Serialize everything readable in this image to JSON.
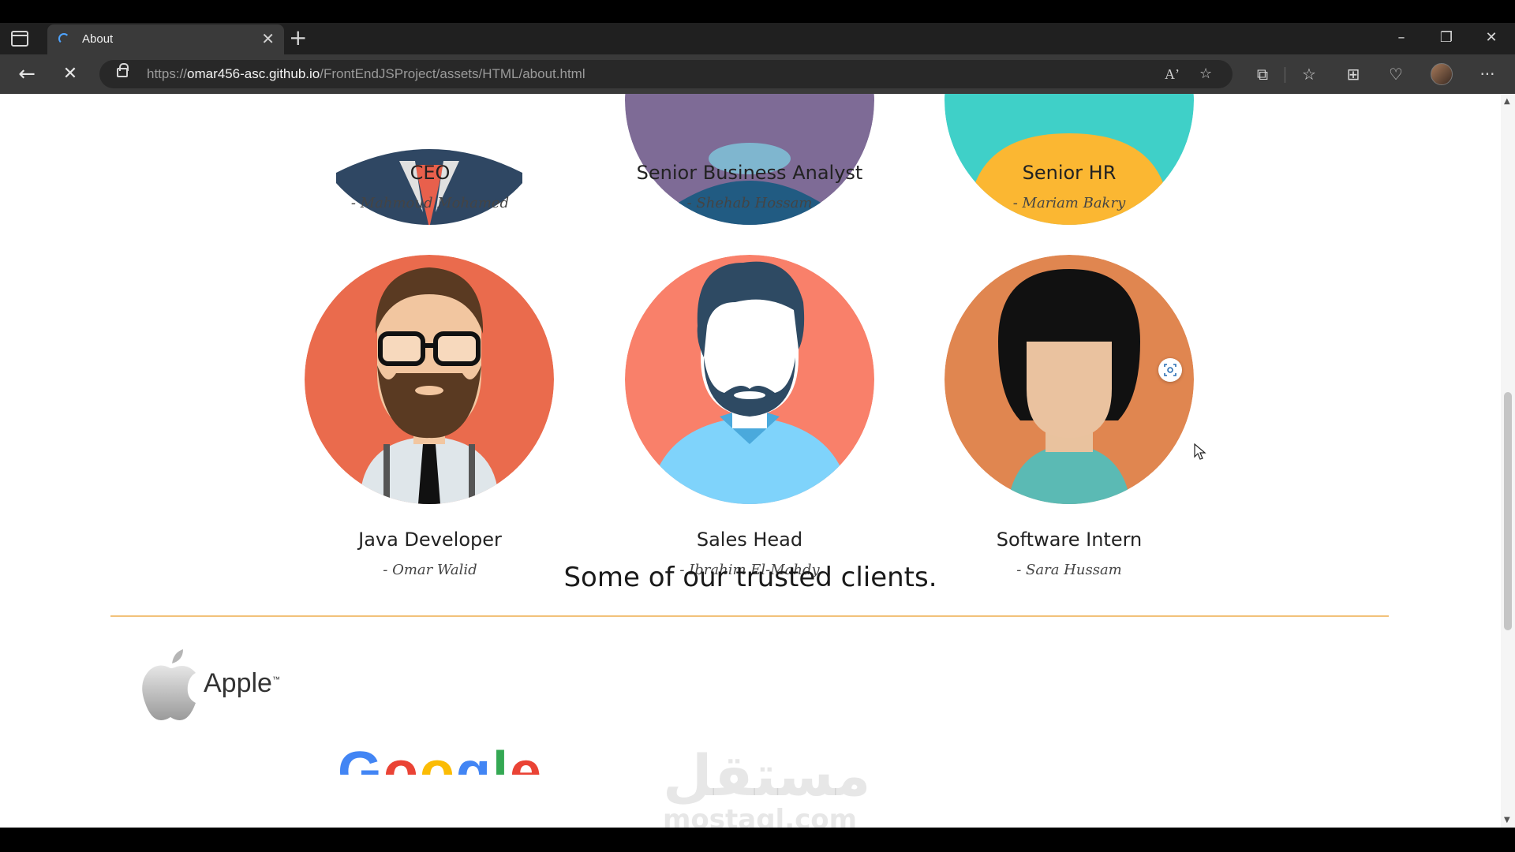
{
  "browser": {
    "tab_title": "About",
    "url_prefix": "https://",
    "url_host": "omar456-asc.github.io",
    "url_path": "/FrontEndJSProject/assets/HTML/about.html",
    "close_tab_glyph": "✕",
    "new_tab_glyph": "+",
    "minimize_glyph": "–",
    "restore_glyph": "❐",
    "close_window_glyph": "✕",
    "back_glyph": "←",
    "stop_glyph": "✕",
    "more_glyph": "···",
    "icons": [
      "tab-actions-icon",
      "back-icon",
      "stop-loading-icon",
      "lock-icon",
      "read-aloud-icon",
      "add-favorite-icon",
      "extensions-icon",
      "favorites-icon",
      "collections-icon",
      "browser-essentials-icon",
      "profile-avatar",
      "settings-more-icon"
    ]
  },
  "team_top": [
    {
      "role": "CEO",
      "name": "- Mahmoud Mohamed"
    },
    {
      "role": "Senior Business Analyst",
      "name": "- Shehab Hossam"
    },
    {
      "role": "Senior HR",
      "name": "- Mariam Bakry"
    }
  ],
  "team_bottom": [
    {
      "role": "Java Developer",
      "name": "- Omar Walid"
    },
    {
      "role": "Sales Head",
      "name": "- Ibrahim El-Mahdy"
    },
    {
      "role": "Software Intern",
      "name": "- Sara Hussam"
    }
  ],
  "clients": {
    "title": "Some of our trusted clients.",
    "apple_label": "Apple",
    "apple_tm": "™",
    "google_label": "Google"
  },
  "watermark": {
    "arabic": "مستقل",
    "latin": "mostaql.com"
  },
  "colors": {
    "accent_divider": "#f2c27a",
    "tab_spinner": "#4ea3ff",
    "google_blue": "#4285F4",
    "google_red": "#EA4335",
    "google_yellow": "#FBBC05",
    "google_green": "#34A853"
  }
}
